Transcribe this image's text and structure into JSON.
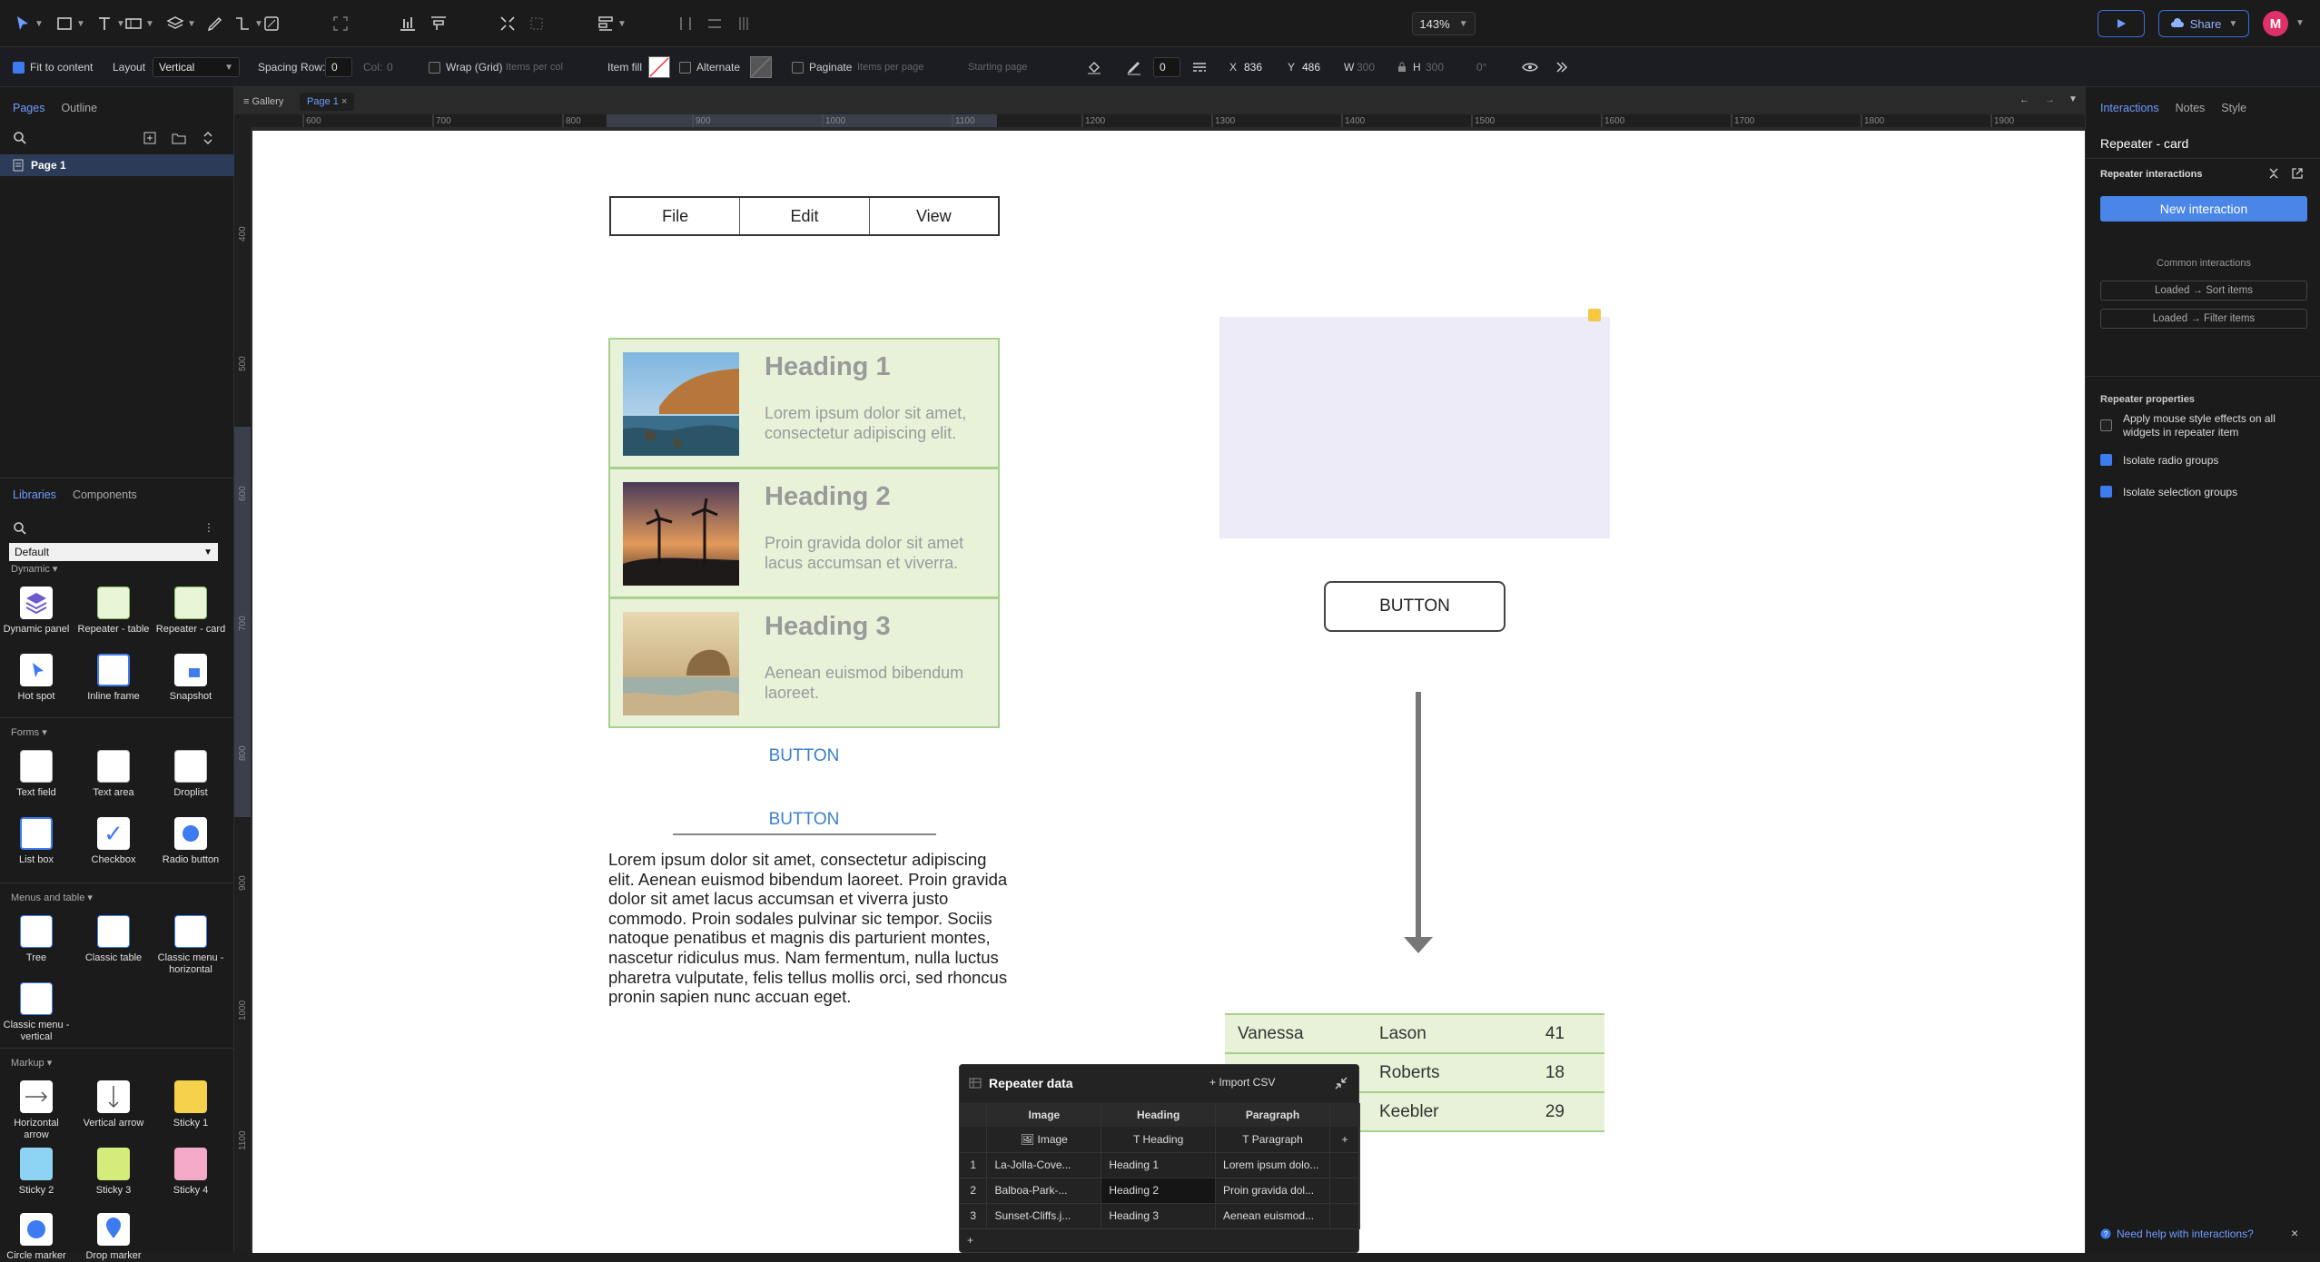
{
  "toolbar": {
    "zoom": "143%",
    "share_label": "Share",
    "avatar_initial": "M"
  },
  "propbar": {
    "fit_to_content": "Fit to content",
    "layout_label": "Layout",
    "layout_value": "Vertical",
    "spacing_label": "Spacing",
    "row_label": "Row:",
    "row_value": "0",
    "col_label": "Col:",
    "col_value": "0",
    "wrap_label": "Wrap (Grid)",
    "items_per_col": "Items per col",
    "item_fill": "Item fill",
    "alternate": "Alternate",
    "paginate": "Paginate",
    "items_per_page": "Items per page",
    "starting_page": "Starting page",
    "stroke_value": "0",
    "x_label": "X",
    "x_value": "836",
    "y_label": "Y",
    "y_value": "486",
    "w_label": "W",
    "w_value": "300",
    "h_label": "H",
    "h_value": "300",
    "rotation": "0°"
  },
  "left": {
    "tab_pages": "Pages",
    "tab_outline": "Outline",
    "page_name": "Page 1",
    "tab_libraries": "Libraries",
    "tab_components": "Components",
    "library_select": "Default",
    "section_dynamic": "Dynamic",
    "section_forms": "Forms",
    "section_menus": "Menus and table",
    "section_markup": "Markup",
    "widgets": {
      "dynamic_panel": "Dynamic panel",
      "repeater_table": "Repeater - table",
      "repeater_card": "Repeater - card",
      "hot_spot": "Hot spot",
      "inline_frame": "Inline frame",
      "snapshot": "Snapshot",
      "text_field": "Text field",
      "text_area": "Text area",
      "droplist": "Droplist",
      "list_box": "List box",
      "checkbox": "Checkbox",
      "radio_button": "Radio button",
      "tree": "Tree",
      "classic_table": "Classic table",
      "classic_menu_h": "Classic menu - horizontal",
      "classic_menu_v": "Classic menu - vertical",
      "h_arrow": "Horizontal arrow",
      "v_arrow": "Vertical arrow",
      "sticky1": "Sticky 1",
      "sticky2": "Sticky 2",
      "sticky3": "Sticky 3",
      "sticky4": "Sticky 4",
      "circle_marker": "Circle marker",
      "drop_marker": "Drop marker"
    }
  },
  "canvas": {
    "tab_gallery": "Gallery",
    "tab_page": "Page 1",
    "ruler_ticks": [
      "600",
      "700",
      "800",
      "900",
      "1000",
      "1100",
      "1200",
      "1300",
      "1400",
      "1500",
      "1600",
      "1700",
      "1800",
      "1900"
    ],
    "ruler_v_ticks": [
      "400",
      "500",
      "600",
      "700",
      "800",
      "900",
      "1000",
      "1100"
    ],
    "menu": [
      "File",
      "Edit",
      "View"
    ],
    "cards": [
      {
        "heading": "Heading 1",
        "text": "Lorem ipsum dolor sit amet, consectetur adipiscing elit."
      },
      {
        "heading": "Heading 2",
        "text": "Proin gravida dolor sit amet lacus accumsan et viverra."
      },
      {
        "heading": "Heading 3",
        "text": "Aenean euismod bibendum laoreet."
      }
    ],
    "link_button_1": "BUTTON",
    "link_button_2": "BUTTON",
    "paragraph": "Lorem ipsum dolor sit amet, consectetur adipiscing elit. Aenean euismod bibendum laoreet. Proin gravida dolor sit amet lacus accumsan et viverra justo commodo. Proin sodales pulvinar sic tempor. Sociis natoque penatibus et magnis dis parturient montes, nascetur ridiculus mus. Nam fermentum, nulla luctus pharetra vulputate, felis tellus mollis orci, sed rhoncus pronin sapien nunc accuan eget.",
    "button": "BUTTON",
    "data_rows": [
      [
        "Vanessa",
        "Lason",
        "41"
      ],
      [
        "",
        "Roberts",
        "18"
      ],
      [
        "",
        "Keebler",
        "29"
      ]
    ]
  },
  "repeater_data": {
    "title": "Repeater data",
    "import_csv": "Import CSV",
    "columns": [
      "Image",
      "Heading",
      "Paragraph"
    ],
    "types": [
      "Image",
      "Heading",
      "Paragraph"
    ],
    "rows": [
      [
        "1",
        "La-Jolla-Cove...",
        "Heading 1",
        "Lorem ipsum dolo..."
      ],
      [
        "2",
        "Balboa-Park-...",
        "Heading 2",
        "Proin gravida dol..."
      ],
      [
        "3",
        "Sunset-Cliffs.j...",
        "Heading 3",
        "Aenean euismod..."
      ]
    ]
  },
  "right": {
    "tab_interactions": "Interactions",
    "tab_notes": "Notes",
    "tab_style": "Style",
    "widget_name": "Repeater - card",
    "repeater_interactions": "Repeater interactions",
    "new_interaction": "New interaction",
    "common_interactions": "Common interactions",
    "common_sort": "Loaded → Sort items",
    "common_filter": "Loaded → Filter items",
    "repeater_properties": "Repeater properties",
    "prop_mouse": "Apply mouse style effects on all widgets in repeater item",
    "prop_radio": "Isolate radio groups",
    "prop_selection": "Isolate selection groups",
    "help": "Need help with interactions?"
  }
}
